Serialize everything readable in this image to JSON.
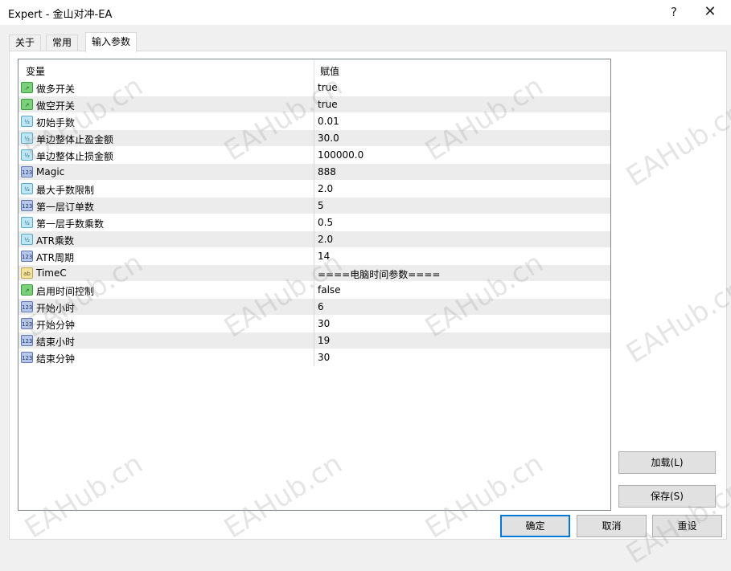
{
  "window": {
    "title": "Expert - 金山对冲-EA",
    "help_label": "?",
    "close_label": "✕"
  },
  "tabs": [
    {
      "label": "关于",
      "active": false
    },
    {
      "label": "常用",
      "active": false
    },
    {
      "label": "输入参数",
      "active": true
    }
  ],
  "grid": {
    "columns": [
      "变量",
      "赋值"
    ],
    "rows": [
      {
        "type": "bool",
        "icon_text": "↗",
        "name": "做多开关",
        "value": "true"
      },
      {
        "type": "bool",
        "icon_text": "↗",
        "name": "做空开关",
        "value": "true"
      },
      {
        "type": "dbl",
        "icon_text": "½",
        "name": "初始手数",
        "value": "0.01"
      },
      {
        "type": "dbl",
        "icon_text": "½",
        "name": "单边整体止盈金额",
        "value": "30.0"
      },
      {
        "type": "dbl",
        "icon_text": "½",
        "name": "单边整体止损金额",
        "value": "100000.0"
      },
      {
        "type": "int",
        "icon_text": "123",
        "name": "Magic",
        "value": "888"
      },
      {
        "type": "dbl",
        "icon_text": "½",
        "name": "最大手数限制",
        "value": "2.0"
      },
      {
        "type": "int",
        "icon_text": "123",
        "name": "第一层订单数",
        "value": "5"
      },
      {
        "type": "dbl",
        "icon_text": "½",
        "name": "第一层手数乘数",
        "value": "0.5"
      },
      {
        "type": "dbl",
        "icon_text": "½",
        "name": "ATR乘数",
        "value": "2.0"
      },
      {
        "type": "int",
        "icon_text": "123",
        "name": "ATR周期",
        "value": "14"
      },
      {
        "type": "str",
        "icon_text": "ab",
        "name": "TimeC",
        "value": "====电脑时间参数===="
      },
      {
        "type": "bool",
        "icon_text": "↗",
        "name": "启用时间控制",
        "value": "false"
      },
      {
        "type": "int",
        "icon_text": "123",
        "name": "开始小时",
        "value": "6"
      },
      {
        "type": "int",
        "icon_text": "123",
        "name": "开始分钟",
        "value": "30"
      },
      {
        "type": "int",
        "icon_text": "123",
        "name": "结束小时",
        "value": "19"
      },
      {
        "type": "int",
        "icon_text": "123",
        "name": "结束分钟",
        "value": "30"
      }
    ]
  },
  "buttons": {
    "load": "加载(L)",
    "save": "保存(S)",
    "ok": "确定",
    "cancel": "取消",
    "reset": "重设"
  },
  "watermark": "EAHub.cn"
}
